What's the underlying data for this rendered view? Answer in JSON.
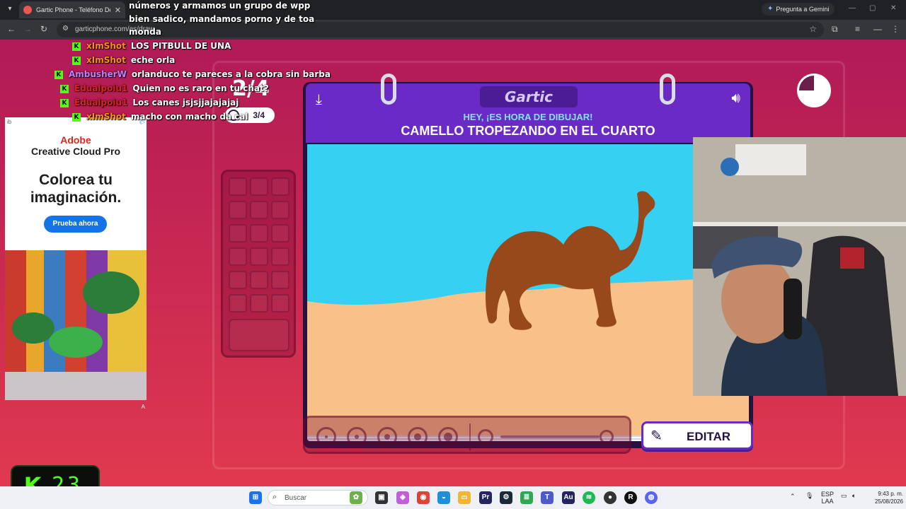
{
  "browser": {
    "tab_title": "Gartic Phone - Teléfono Descon",
    "url": "garticphone.com/es/draw",
    "gemini_label": "Pregunta a Gemini"
  },
  "game": {
    "round_big": "2/4",
    "round_pill": "3/4",
    "logo": "Gartic",
    "subtitle": "HEY, ¡ES HORA DE DIBUJAR!",
    "task": "CAMELLO TROPEZANDO EN EL CUARTO",
    "edit_label": "EDITAR",
    "brush_sizes": [
      1,
      2,
      3,
      4,
      5
    ],
    "slider_value": 1.0,
    "timer_remaining_fraction": 0.75
  },
  "ad": {
    "badge": "i▷",
    "info": "ib",
    "brand": "Adobe",
    "product": "Creative Cloud Pro",
    "headline": "Colorea tu imaginación.",
    "cta": "Prueba ahora",
    "corner": "A"
  },
  "chat": {
    "lines_top": [
      "números y armamos un grupo de wpp",
      "bien sadico, mandamos porno y de toa",
      "monda"
    ],
    "messages": [
      {
        "user": "xImShot",
        "text": "LOS PITBULL DE UNA",
        "color": "#ff8c1a"
      },
      {
        "user": "xImShot",
        "text": "eche orla",
        "color": "#ff8c1a"
      },
      {
        "user": "AmbusherW",
        "text": "orlanduco te pareces a la cobra sin barba",
        "color": "#c77dff"
      },
      {
        "user": "Edualpoiu1",
        "text": "Quien no es raro en tu chat?",
        "color": "#d22"
      },
      {
        "user": "Edualpoiu1",
        "text": "Los canes jsjsjjajajajaj",
        "color": "#d22"
      },
      {
        "user": "xImShot",
        "text": "macho con macho da cal",
        "color": "#ff8c1a"
      }
    ]
  },
  "kick": {
    "letter": "K",
    "count": "23"
  },
  "taskbar": {
    "search_label": "Buscar",
    "lang_top": "ESP",
    "lang_bottom": "LAA",
    "time": "9:43 p. m.",
    "date": "25/08/2026"
  }
}
